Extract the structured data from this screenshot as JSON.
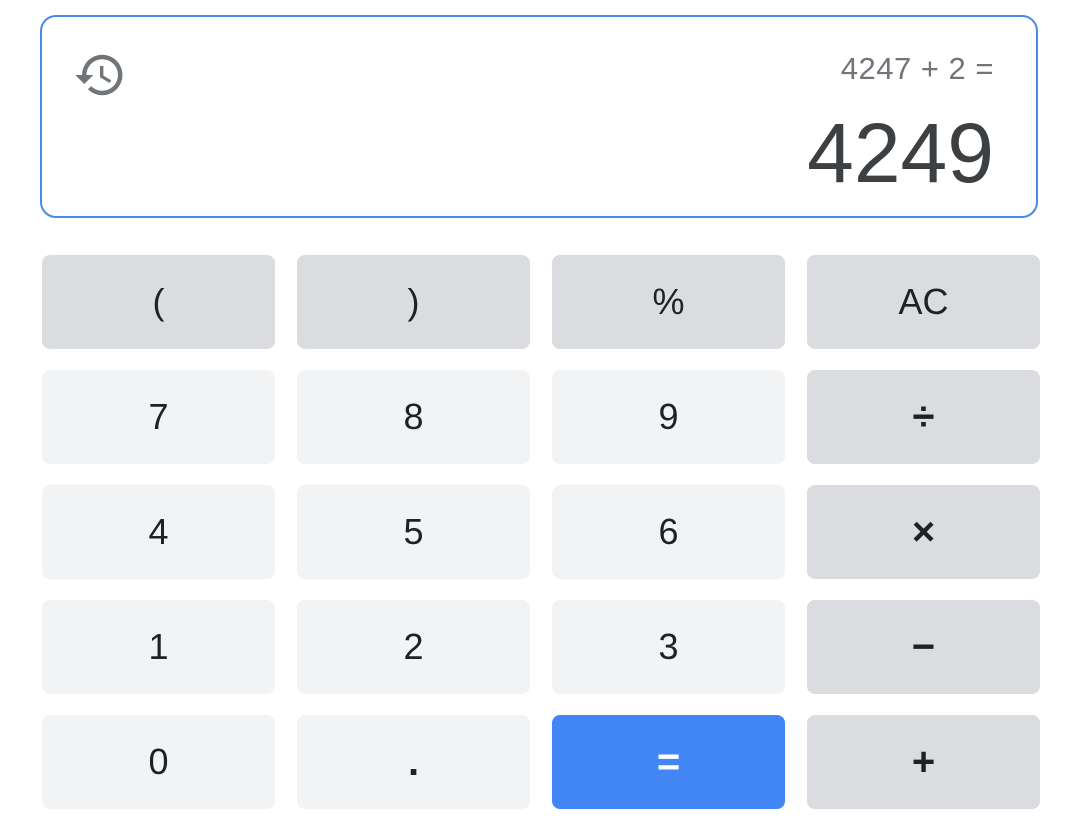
{
  "display": {
    "expression": "4247 + 2 =",
    "result": "4249",
    "history_icon": "history-icon"
  },
  "colors": {
    "display_border": "#4a89e8",
    "function_key_bg": "#dadce0",
    "number_key_bg": "#f1f3f4",
    "equals_key_bg": "#4285f4",
    "text": "#202124"
  },
  "keys": {
    "open_paren": "(",
    "close_paren": ")",
    "percent": "%",
    "clear": "AC",
    "seven": "7",
    "eight": "8",
    "nine": "9",
    "divide": "÷",
    "four": "4",
    "five": "5",
    "six": "6",
    "multiply": "×",
    "one": "1",
    "two": "2",
    "three": "3",
    "minus": "−",
    "zero": "0",
    "decimal": ".",
    "equals": "=",
    "plus": "+"
  }
}
